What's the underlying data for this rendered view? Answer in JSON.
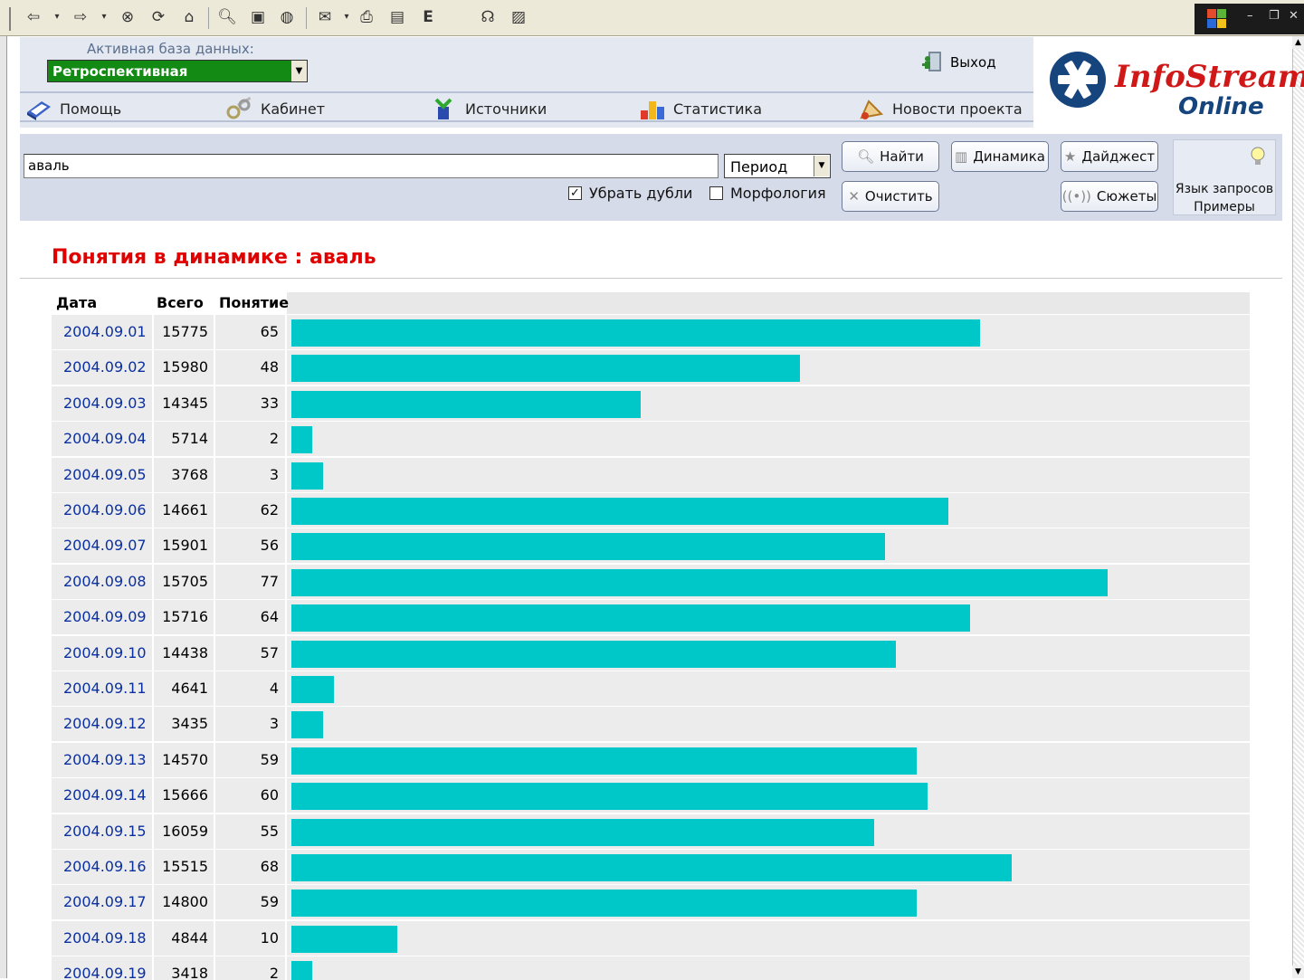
{
  "header": {
    "db_label": "Активная база данных:",
    "db_value": "Ретроспективная",
    "exit_label": "Выход",
    "nav": [
      {
        "label": "Помощь"
      },
      {
        "label": "Кабинет"
      },
      {
        "label": "Источники"
      },
      {
        "label": "Статистика"
      },
      {
        "label": "Новости проекта"
      }
    ]
  },
  "logo": {
    "line1": "InfoStream",
    "line2": "Online"
  },
  "search": {
    "query": "аваль",
    "period": "Период",
    "remove_dups_label": "Убрать дубли",
    "remove_dups_checked": true,
    "morphology_label": "Морфология",
    "morphology_checked": false,
    "find_label": "Найти",
    "dynamics_label": "Динамика",
    "digest_label": "Дайджест",
    "clear_label": "Очистить",
    "stories_label": "Сюжеты",
    "query_lang_label": "Язык запросов",
    "examples_label": "Примеры"
  },
  "page_title": "Понятия в динамике : аваль",
  "table": {
    "headers": [
      "Дата",
      "Всего",
      "Понятие"
    ],
    "bar_max": 90,
    "rows": [
      {
        "date": "2004.09.01",
        "total": "15775",
        "count": 65
      },
      {
        "date": "2004.09.02",
        "total": "15980",
        "count": 48
      },
      {
        "date": "2004.09.03",
        "total": "14345",
        "count": 33
      },
      {
        "date": "2004.09.04",
        "total": "5714",
        "count": 2
      },
      {
        "date": "2004.09.05",
        "total": "3768",
        "count": 3
      },
      {
        "date": "2004.09.06",
        "total": "14661",
        "count": 62
      },
      {
        "date": "2004.09.07",
        "total": "15901",
        "count": 56
      },
      {
        "date": "2004.09.08",
        "total": "15705",
        "count": 77
      },
      {
        "date": "2004.09.09",
        "total": "15716",
        "count": 64
      },
      {
        "date": "2004.09.10",
        "total": "14438",
        "count": 57
      },
      {
        "date": "2004.09.11",
        "total": "4641",
        "count": 4
      },
      {
        "date": "2004.09.12",
        "total": "3435",
        "count": 3
      },
      {
        "date": "2004.09.13",
        "total": "14570",
        "count": 59
      },
      {
        "date": "2004.09.14",
        "total": "15666",
        "count": 60
      },
      {
        "date": "2004.09.15",
        "total": "16059",
        "count": 55
      },
      {
        "date": "2004.09.16",
        "total": "15515",
        "count": 68
      },
      {
        "date": "2004.09.17",
        "total": "14800",
        "count": 59
      },
      {
        "date": "2004.09.18",
        "total": "4844",
        "count": 10
      },
      {
        "date": "2004.09.19",
        "total": "3418",
        "count": 2
      }
    ]
  },
  "colors": {
    "bar": "#00c8c8",
    "title": "#e00000",
    "link": "#0a2fa0",
    "db_select": "#138a13"
  }
}
